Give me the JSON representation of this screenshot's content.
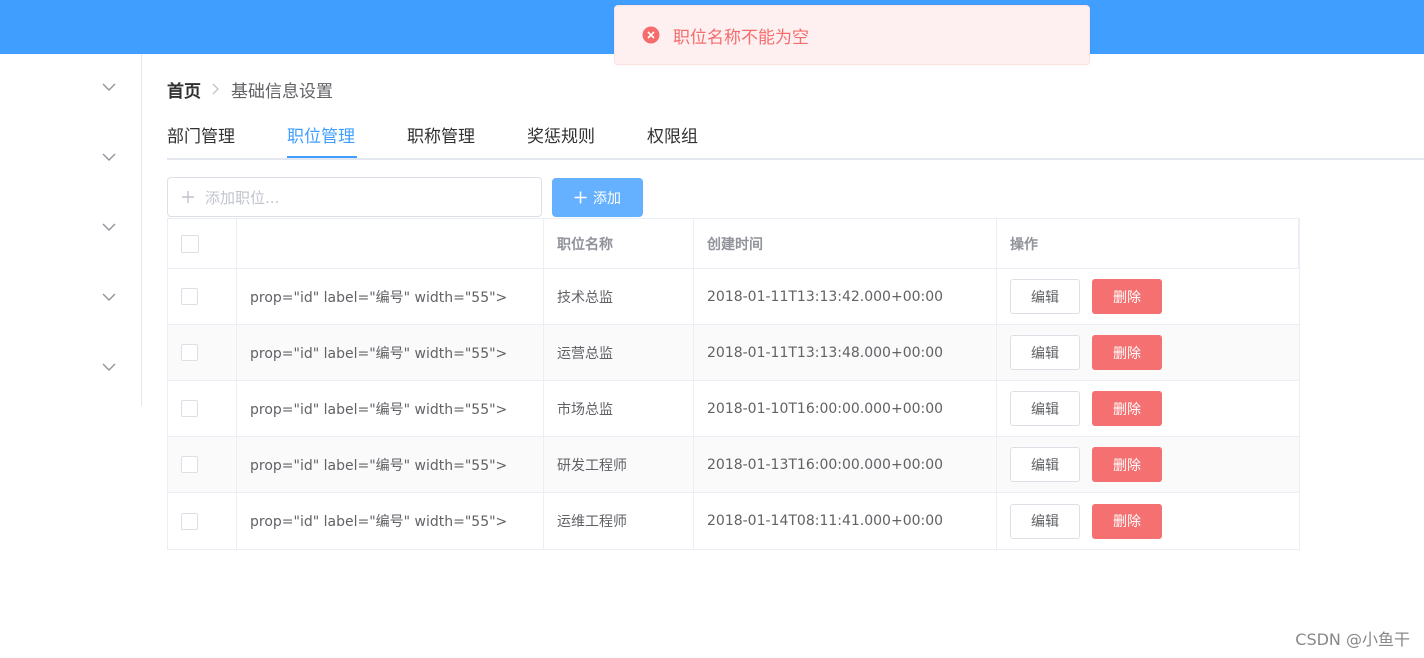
{
  "toast": {
    "message": "职位名称不能为空",
    "color": "#f56c6c"
  },
  "breadcrumb": {
    "home": "首页",
    "current": "基础信息设置"
  },
  "tabs": [
    {
      "label": "部门管理",
      "active": false
    },
    {
      "label": "职位管理",
      "active": true
    },
    {
      "label": "职称管理",
      "active": false
    },
    {
      "label": "奖惩规则",
      "active": false
    },
    {
      "label": "权限组",
      "active": false
    }
  ],
  "add": {
    "placeholder": "添加职位...",
    "button_label": "添加"
  },
  "table": {
    "columns": [
      "",
      "",
      "职位名称",
      "创建时间",
      "操作"
    ],
    "rows": [
      {
        "id_cell": "prop=\"id\" label=\"编号\" width=\"55\">",
        "name": "技术总监",
        "created": "2018-01-11T13:13:42.000+00:00"
      },
      {
        "id_cell": "prop=\"id\" label=\"编号\" width=\"55\">",
        "name": "运营总监",
        "created": "2018-01-11T13:13:48.000+00:00"
      },
      {
        "id_cell": "prop=\"id\" label=\"编号\" width=\"55\">",
        "name": "市场总监",
        "created": "2018-01-10T16:00:00.000+00:00"
      },
      {
        "id_cell": "prop=\"id\" label=\"编号\" width=\"55\">",
        "name": "研发工程师",
        "created": "2018-01-13T16:00:00.000+00:00"
      },
      {
        "id_cell": "prop=\"id\" label=\"编号\" width=\"55\">",
        "name": "运维工程师",
        "created": "2018-01-14T08:11:41.000+00:00"
      }
    ],
    "edit_label": "编辑",
    "delete_label": "删除"
  },
  "watermark": "CSDN @小鱼干",
  "colors": {
    "primary": "#409eff",
    "danger": "#f56c6c",
    "topbar": "#409eff"
  }
}
